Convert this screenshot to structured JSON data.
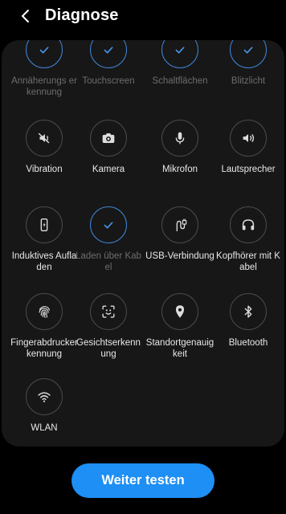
{
  "header": {
    "title": "Diagnose"
  },
  "tests": [
    {
      "label": "Annäherungs erkennung",
      "icon": "check-icon",
      "done": true
    },
    {
      "label": "Touchscreen",
      "icon": "check-icon",
      "done": true
    },
    {
      "label": "Schaltflächen",
      "icon": "check-icon",
      "done": true
    },
    {
      "label": "Blitzlicht",
      "icon": "check-icon",
      "done": true
    },
    {
      "label": "Vibration",
      "icon": "vibration-icon",
      "done": false
    },
    {
      "label": "Kamera",
      "icon": "camera-icon",
      "done": false
    },
    {
      "label": "Mikrofon",
      "icon": "microphone-icon",
      "done": false
    },
    {
      "label": "Lautsprecher",
      "icon": "speaker-icon",
      "done": false
    },
    {
      "label": "Induktives Aufladen",
      "icon": "wireless-charging-icon",
      "done": false
    },
    {
      "label": "Laden über Kabel",
      "icon": "check-icon",
      "done": true
    },
    {
      "label": "USB-Verbindung",
      "icon": "usb-icon",
      "done": false
    },
    {
      "label": "Kopfhörer mit Kabel",
      "icon": "headphones-icon",
      "done": false
    },
    {
      "label": "Fingerabdruckerkennung",
      "icon": "fingerprint-icon",
      "done": false
    },
    {
      "label": "Gesichtserkennung",
      "icon": "face-recognition-icon",
      "done": false
    },
    {
      "label": "Standortgenauigkeit",
      "icon": "location-icon",
      "done": false
    },
    {
      "label": "Bluetooth",
      "icon": "bluetooth-icon",
      "done": false
    },
    {
      "label": "WLAN",
      "icon": "wifi-icon",
      "done": false
    }
  ],
  "footer": {
    "button_label": "Weiter testen"
  },
  "colors": {
    "accent": "#1e8ff5",
    "done_ring": "#3e86d8",
    "panel": "#171717"
  }
}
